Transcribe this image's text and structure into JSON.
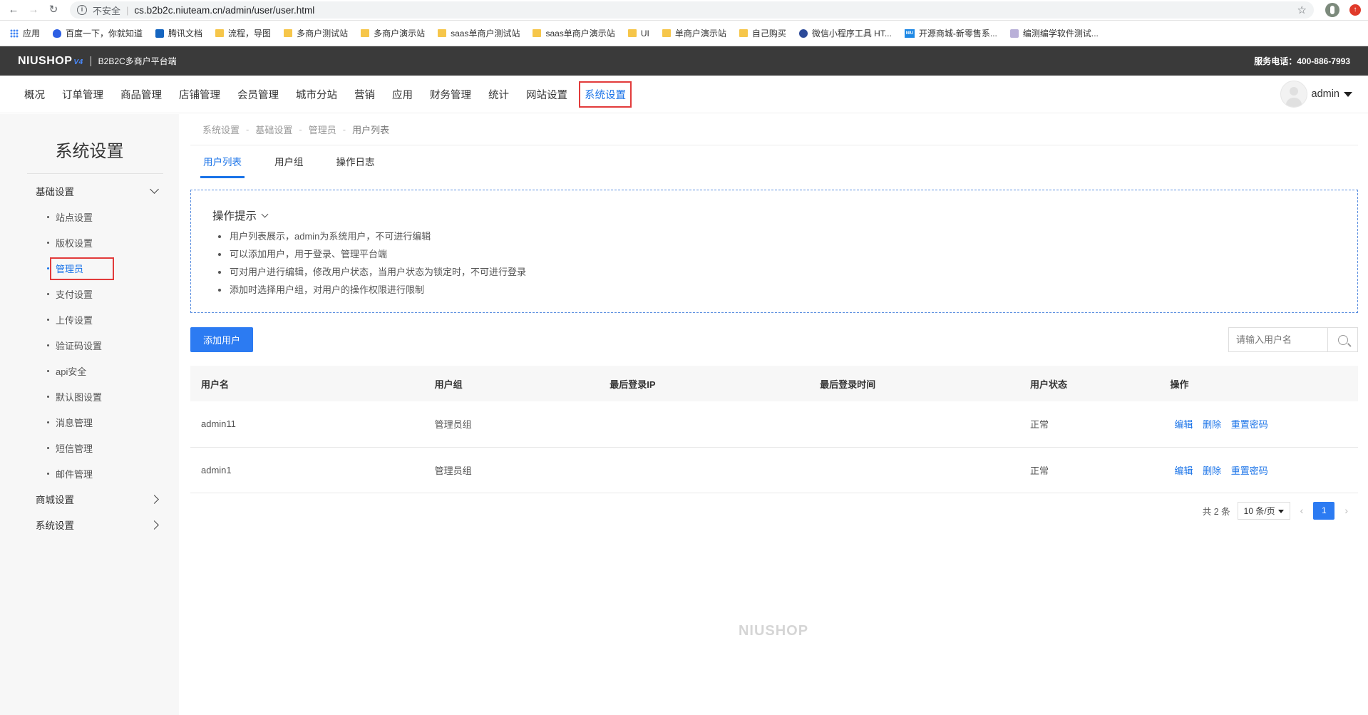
{
  "browser": {
    "insecure_label": "不安全",
    "url": "cs.b2b2c.niuteam.cn/admin/user/user.html",
    "bookmarks": [
      {
        "label": "应用",
        "icon": "apps-icon"
      },
      {
        "label": "百度一下，你就知道",
        "icon": "baidu-icon"
      },
      {
        "label": "腾讯文档",
        "icon": "tencent-docs-icon"
      },
      {
        "label": "流程，导图",
        "icon": "folder-icon"
      },
      {
        "label": "多商户测试站",
        "icon": "folder-icon"
      },
      {
        "label": "多商户演示站",
        "icon": "folder-icon"
      },
      {
        "label": "saas单商户测试站",
        "icon": "folder-icon"
      },
      {
        "label": "saas单商户演示站",
        "icon": "folder-icon"
      },
      {
        "label": "UI",
        "icon": "folder-icon"
      },
      {
        "label": "单商户演示站",
        "icon": "folder-icon"
      },
      {
        "label": "自己购买",
        "icon": "folder-icon"
      },
      {
        "label": "微信小程序工具 HT...",
        "icon": "wechat-tool-icon"
      },
      {
        "label": "开源商城-新零售系...",
        "icon": "niu-icon"
      },
      {
        "label": "编测编学软件测试...",
        "icon": "bookmark-icon"
      }
    ]
  },
  "header": {
    "logo": "NIUSHOP",
    "logo_version": "V4",
    "subtitle": "B2B2C多商户平台端",
    "phone": "服务电话：400-886-7993"
  },
  "topnav": {
    "items": [
      "概况",
      "订单管理",
      "商品管理",
      "店铺管理",
      "会员管理",
      "城市分站",
      "营销",
      "应用",
      "财务管理",
      "统计",
      "网站设置",
      "系统设置"
    ],
    "active": "系统设置",
    "user": "admin"
  },
  "sidebar": {
    "title": "系统设置",
    "group1": "基础设置",
    "items": [
      "站点设置",
      "版权设置",
      "管理员",
      "支付设置",
      "上传设置",
      "验证码设置",
      "api安全",
      "默认图设置",
      "消息管理",
      "短信管理",
      "邮件管理"
    ],
    "active": "管理员",
    "group2": "商城设置",
    "group3": "系统设置"
  },
  "breadcrumb": [
    "系统设置",
    "基础设置",
    "管理员",
    "用户列表"
  ],
  "tabs": [
    "用户列表",
    "用户组",
    "操作日志"
  ],
  "tips": {
    "title": "操作提示",
    "items": [
      "用户列表展示，admin为系统用户，不可进行编辑",
      "可以添加用户，用于登录、管理平台端",
      "可对用户进行编辑，修改用户状态，当用户状态为锁定时，不可进行登录",
      "添加时选择用户组，对用户的操作权限进行限制"
    ]
  },
  "toolbar": {
    "add_label": "添加用户",
    "search_placeholder": "请输入用户名"
  },
  "table": {
    "columns": [
      "用户名",
      "用户组",
      "最后登录IP",
      "最后登录时间",
      "用户状态",
      "操作"
    ],
    "rows": [
      {
        "username": "admin11",
        "group": "管理员组",
        "ip": "",
        "time": "",
        "status": "正常"
      },
      {
        "username": "admin1",
        "group": "管理员组",
        "ip": "",
        "time": "",
        "status": "正常"
      }
    ],
    "actions": [
      "编辑",
      "删除",
      "重置密码"
    ]
  },
  "pager": {
    "total": "共 2 条",
    "page_size": "10 条/页",
    "current": "1"
  },
  "footer": {
    "logo": "NIUSHOP"
  },
  "colors": {
    "accent": "#2c7bf2",
    "highlight_box": "#e23b3b",
    "header_bg": "#3a3a3a"
  }
}
